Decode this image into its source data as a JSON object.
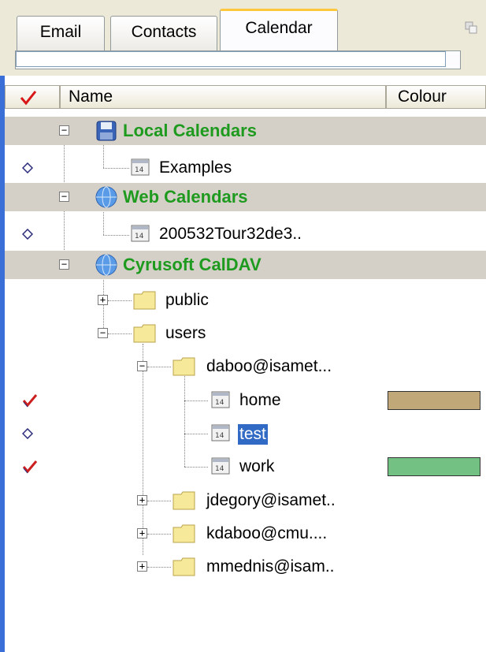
{
  "tabs": [
    {
      "label": "Email"
    },
    {
      "label": "Contacts"
    },
    {
      "label": "Calendar"
    }
  ],
  "columns": {
    "check": "",
    "name": "Name",
    "colour": "Colour"
  },
  "tree": {
    "local": {
      "label": "Local Calendars",
      "items": [
        {
          "label": "Examples",
          "icon": "calendar-icon",
          "marker": "diamond"
        }
      ]
    },
    "web": {
      "label": "Web Calendars",
      "items": [
        {
          "label": "200532Tour32de3..",
          "icon": "calendar-icon",
          "marker": "diamond"
        }
      ]
    },
    "caldav": {
      "label": "Cyrusoft CalDAV",
      "public": {
        "label": "public"
      },
      "users": {
        "label": "users",
        "daboo": {
          "label": "daboo@isamet...",
          "calendars": [
            {
              "label": "home",
              "marker": "check",
              "colour": "#c0a878"
            },
            {
              "label": "test",
              "marker": "diamond",
              "selected": true
            },
            {
              "label": "work",
              "marker": "check",
              "colour": "#74c184"
            }
          ]
        },
        "others": [
          {
            "label": "jdegory@isamet.."
          },
          {
            "label": "kdaboo@cmu...."
          },
          {
            "label": "mmednis@isam.."
          }
        ]
      }
    }
  },
  "colors": {
    "group_text": "#1e9a1e",
    "selection": "#316ac5",
    "panel_border": "#3a6fd8",
    "active_tab_accent": "#ffc83c"
  }
}
